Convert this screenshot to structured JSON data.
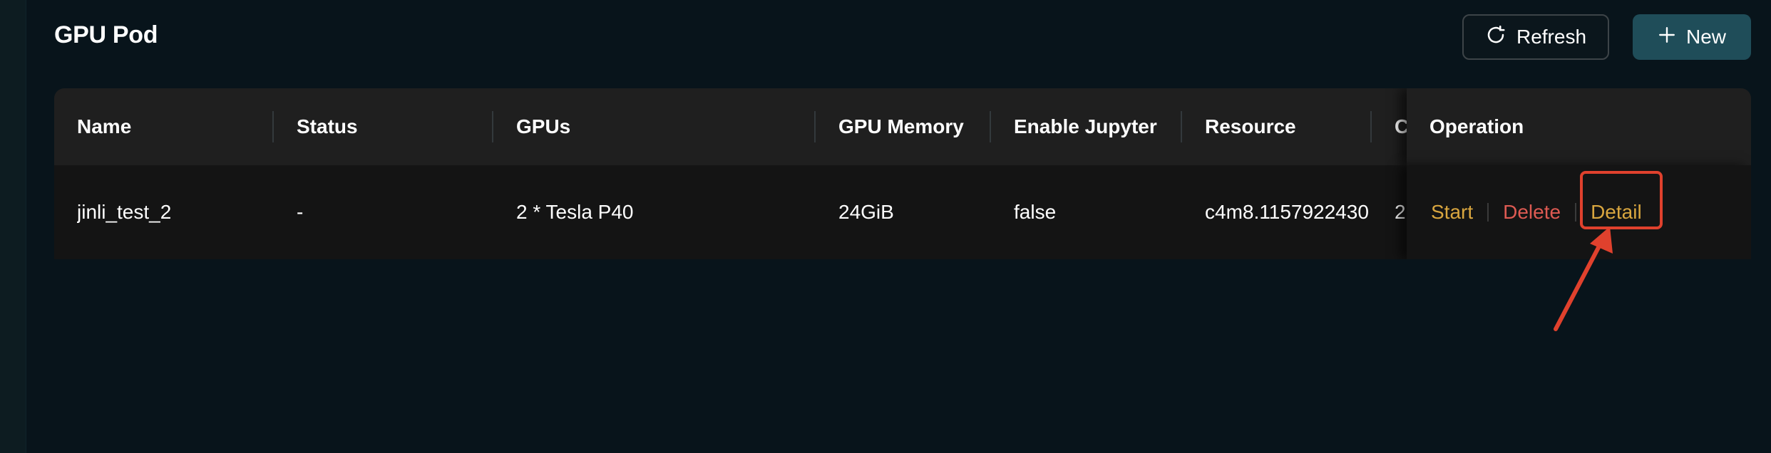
{
  "header": {
    "title": "GPU Pod",
    "refresh_label": "Refresh",
    "new_label": "New"
  },
  "table": {
    "columns": {
      "name": "Name",
      "status": "Status",
      "gpus": "GPUs",
      "gpu_memory": "GPU Memory",
      "enable_jupyter": "Enable Jupyter",
      "resource": "Resource",
      "truncated": "C",
      "operation": "Operation"
    },
    "rows": [
      {
        "name": "jinli_test_2",
        "status": "-",
        "gpus": "2 * Tesla P40",
        "gpu_memory": "24GiB",
        "enable_jupyter": "false",
        "resource": "c4m8.1157922430",
        "truncated": "2",
        "ops": {
          "start": "Start",
          "delete": "Delete",
          "detail": "Detail"
        }
      }
    ]
  },
  "colors": {
    "background": "#08141b",
    "link": "#d9a63f",
    "danger": "#dd5a52",
    "primary_button": "#1f4d59",
    "annotation": "#e0412d"
  },
  "icons": {
    "refresh": "refresh-icon",
    "new": "plus-icon",
    "annotation": "arrow-annotation-icon"
  }
}
